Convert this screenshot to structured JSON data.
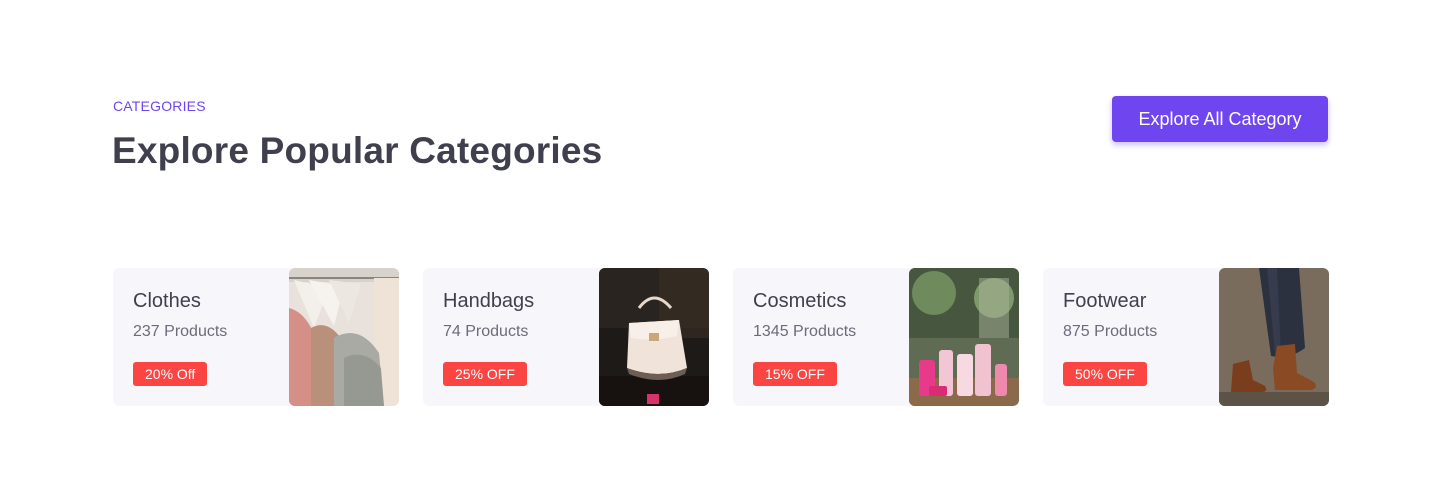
{
  "header": {
    "eyebrow": "CATEGORIES",
    "title": "Explore Popular Categories",
    "cta_label": "Explore All Category"
  },
  "categories": [
    {
      "name": "Clothes",
      "count": "237 Products",
      "discount": "20% Off",
      "image": "clothes-rack-image"
    },
    {
      "name": "Handbags",
      "count": "74 Products",
      "discount": "25% OFF",
      "image": "white-handbag-image"
    },
    {
      "name": "Cosmetics",
      "count": "1345 Products",
      "discount": "15% OFF",
      "image": "cosmetics-bottles-image"
    },
    {
      "name": "Footwear",
      "count": "875 Products",
      "discount": "50% OFF",
      "image": "leather-boots-image"
    }
  ],
  "colors": {
    "accent": "#6e45ee",
    "badge": "#fb4543",
    "card_bg": "#f7f7fb",
    "heading": "#3f3f4e"
  }
}
